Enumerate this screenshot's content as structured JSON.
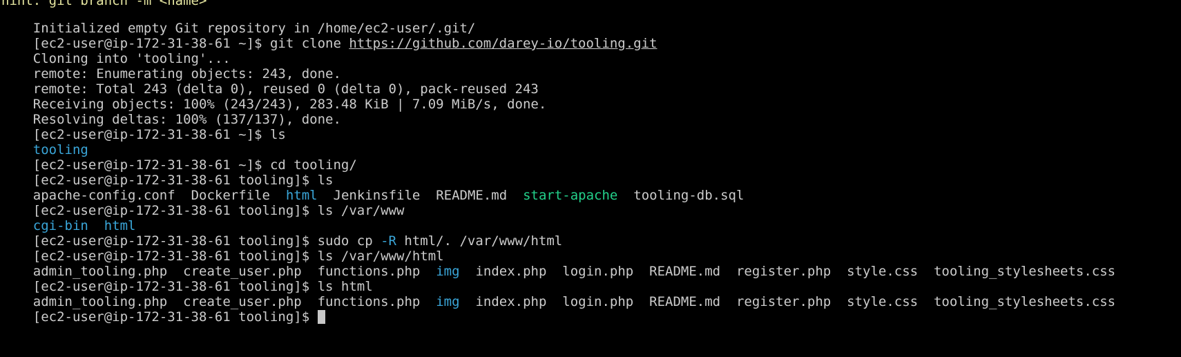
{
  "partial_top": "hint: git branch -m <name>",
  "lines": {
    "l01": {
      "text": "Initialized empty Git repository in /home/ec2-user/.git/"
    },
    "l02": {
      "prompt": "[ec2-user@ip-172-31-38-61 ~]$ ",
      "cmd": "git clone ",
      "url": "https://github.com/darey-io/tooling.git"
    },
    "l03": {
      "text": "Cloning into 'tooling'..."
    },
    "l04": {
      "text": "remote: Enumerating objects: 243, done."
    },
    "l05": {
      "text": "remote: Total 243 (delta 0), reused 0 (delta 0), pack-reused 243"
    },
    "l06": {
      "text": "Receiving objects: 100% (243/243), 283.48 KiB | 7.09 MiB/s, done."
    },
    "l07": {
      "text": "Resolving deltas: 100% (137/137), done."
    },
    "l08": {
      "prompt": "[ec2-user@ip-172-31-38-61 ~]$ ",
      "cmd": "ls"
    },
    "l09": {
      "dir": "tooling"
    },
    "l10": {
      "prompt": "[ec2-user@ip-172-31-38-61 ~]$ ",
      "cmd": "cd tooling/"
    },
    "l11": {
      "prompt": "[ec2-user@ip-172-31-38-61 tooling]$ ",
      "cmd": "ls"
    },
    "l12": {
      "f1": "apache-config.conf",
      "f2": "Dockerfile",
      "d1": "html",
      "f3": "Jenkinsfile",
      "f4": "README.md",
      "x1": "start-apache",
      "f5": "tooling-db.sql"
    },
    "l13": {
      "prompt": "[ec2-user@ip-172-31-38-61 tooling]$ ",
      "cmd": "ls /var/www"
    },
    "l14": {
      "d1": "cgi-bin",
      "d2": "html"
    },
    "l15": {
      "prompt": "[ec2-user@ip-172-31-38-61 tooling]$ ",
      "cmd1": "sudo cp ",
      "flag": "-R",
      "cmd2": " html/. /var/www/html"
    },
    "l16": {
      "prompt": "[ec2-user@ip-172-31-38-61 tooling]$ ",
      "cmd": "ls /var/www/html"
    },
    "l17": {
      "f1": "admin_tooling.php",
      "f2": "create_user.php",
      "f3": "functions.php",
      "d1": "img",
      "f4": "index.php",
      "f5": "login.php",
      "f6": "README.md",
      "f7": "register.php",
      "f8": "style.css",
      "f9": "tooling_stylesheets.css"
    },
    "l18": {
      "prompt": "[ec2-user@ip-172-31-38-61 tooling]$ ",
      "cmd": "ls html"
    },
    "l19": {
      "f1": "admin_tooling.php",
      "f2": "create_user.php",
      "f3": "functions.php",
      "d1": "img",
      "f4": "index.php",
      "f5": "login.php",
      "f6": "README.md",
      "f7": "register.php",
      "f8": "style.css",
      "f9": "tooling_stylesheets.css"
    },
    "l20": {
      "prompt": "[ec2-user@ip-172-31-38-61 tooling]$ "
    }
  },
  "colors": {
    "background": "#000000",
    "text": "#cccccc",
    "directory": "#3aa6d9",
    "executable": "#23d18b",
    "cursor": "#c8c8c8"
  }
}
